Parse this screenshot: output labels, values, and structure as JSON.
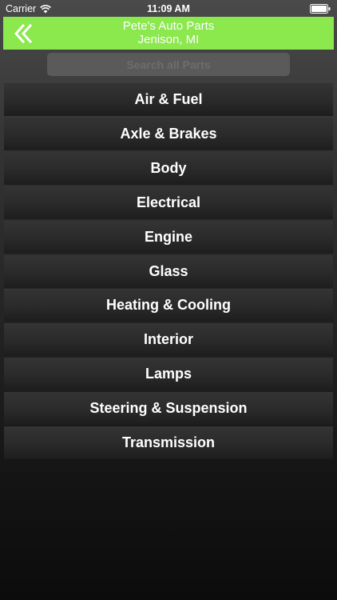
{
  "status_bar": {
    "carrier": "Carrier",
    "time": "11:09 AM"
  },
  "header": {
    "title": "Pete's Auto Parts",
    "subtitle": "Jenison, MI",
    "background_color": "#8be84d",
    "back_icon": "double-chevron-left-icon"
  },
  "search": {
    "placeholder": "Search all Parts",
    "value": ""
  },
  "categories": [
    "Air & Fuel",
    "Axle & Brakes",
    "Body",
    "Electrical",
    "Engine",
    "Glass",
    "Heating & Cooling",
    "Interior",
    "Lamps",
    "Steering & Suspension",
    "Transmission"
  ]
}
